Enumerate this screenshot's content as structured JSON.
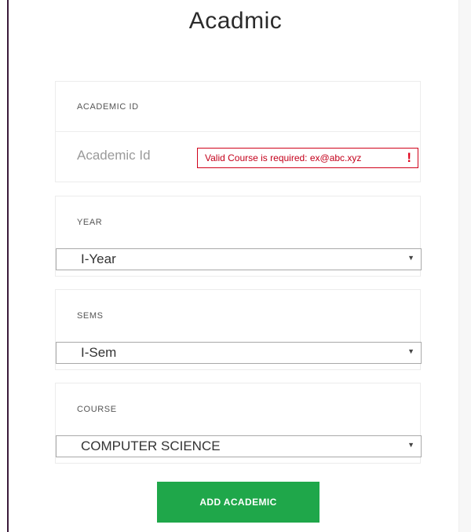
{
  "page": {
    "title": "Acadmic"
  },
  "academic_id": {
    "label": "ACADEMIC ID",
    "placeholder": "Academic Id",
    "value": "",
    "error": "Valid Course is required: ex@abc.xyz",
    "error_icon": "!"
  },
  "year": {
    "label": "YEAR",
    "selected": "I-Year"
  },
  "sems": {
    "label": "SEMS",
    "selected": "I-Sem"
  },
  "course": {
    "label": "COURSE",
    "selected": "COMPUTER SCIENCE"
  },
  "actions": {
    "submit_label": "ADD ACADEMIC"
  },
  "icons": {
    "caret": "caret-down-icon",
    "error": "exclamation-icon"
  },
  "colors": {
    "accent": "#1fa74a",
    "error": "#d0021b",
    "sidebar_rule": "#3b1a3a"
  }
}
